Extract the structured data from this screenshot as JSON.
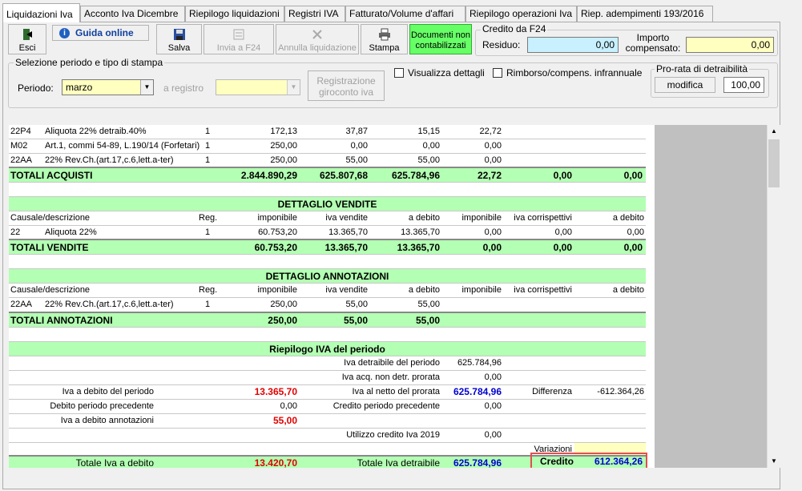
{
  "tabs": [
    "Liquidazioni Iva",
    "Acconto Iva Dicembre",
    "Riepilogo liquidazioni",
    "Registri IVA",
    "Fatturato/Volume d'affari",
    "Riepilogo operazioni Iva",
    "Riep. adempimenti 193/2016"
  ],
  "toolbar": {
    "esci": "Esci",
    "guida": "Guida online",
    "salva": "Salva",
    "invia": "Invia a F24",
    "annulla": "Annulla liquidazione",
    "stampa": "Stampa",
    "documenti_l1": "Documenti non",
    "documenti_l2": "contabilizzati"
  },
  "credito_f24": {
    "title": "Credito da F24",
    "residuo_label": "Residuo:",
    "residuo_value": "0,00",
    "importo_label_l1": "Importo",
    "importo_label_l2": "compensato:",
    "importo_value": "0,00"
  },
  "selezione": {
    "title": "Selezione periodo e tipo di stampa",
    "periodo_label": "Periodo:",
    "periodo_value": "marzo",
    "registro_label": "a registro",
    "registro_value": "",
    "registrazione_l1": "Registrazione",
    "registrazione_l2": "giroconto iva",
    "visualizza": "Visualizza dettagli",
    "rimborso": "Rimborso/compens. infrannuale"
  },
  "prorata": {
    "title": "Pro-rata di detraibilità",
    "modifica": "modifica",
    "value": "100,00"
  },
  "acquisti_rows": [
    [
      "22P4",
      "Aliquota 22% detraib.40%",
      "1",
      "172,13",
      "37,87",
      "15,15",
      "22,72"
    ],
    [
      "M02",
      "Art.1, commi 54-89, L.190/14 (Forfetari)",
      "1",
      "250,00",
      "0,00",
      "0,00",
      "0,00"
    ],
    [
      "22AA",
      "22% Rev.Ch.(art.17,c.6,lett.a-ter)",
      "1",
      "250,00",
      "55,00",
      "55,00",
      "0,00"
    ]
  ],
  "totali_acquisti": [
    "TOTALI ACQUISTI",
    "2.844.890,29",
    "625.807,68",
    "625.784,96",
    "22,72",
    "0,00",
    "0,00"
  ],
  "vendite": {
    "title": "DETTAGLIO VENDITE",
    "headers": [
      "Causale/descrizione",
      "Reg.",
      "imponibile",
      "iva vendite",
      "a debito",
      "imponibile",
      "iva corrispettivi",
      "a debito"
    ],
    "rows": [
      [
        "22",
        "Aliquota 22%",
        "1",
        "60.753,20",
        "13.365,70",
        "13.365,70",
        "0,00",
        "0,00",
        "0,00"
      ]
    ],
    "totali": [
      "TOTALI VENDITE",
      "60.753,20",
      "13.365,70",
      "13.365,70",
      "0,00",
      "0,00",
      "0,00"
    ]
  },
  "annotazioni": {
    "title": "DETTAGLIO ANNOTAZIONI",
    "headers": [
      "Causale/descrizione",
      "Reg.",
      "imponibile",
      "iva vendite",
      "a debito",
      "imponibile",
      "iva corrispettivi",
      "a debito"
    ],
    "rows": [
      [
        "22AA",
        "22% Rev.Ch.(art.17,c.6,lett.a-ter)",
        "1",
        "250,00",
        "55,00",
        "55,00"
      ]
    ],
    "totali": [
      "TOTALI ANNOTAZIONI",
      "250,00",
      "55,00",
      "55,00"
    ]
  },
  "riepilogo": {
    "title": "Riepilogo IVA del periodo",
    "iva_detraibile_label": "Iva detraibile del periodo",
    "iva_detraibile_value": "625.784,96",
    "iva_acq_label": "Iva acq. non detr. prorata",
    "iva_acq_value": "0,00",
    "iva_debito_label": "Iva a debito del periodo",
    "iva_debito_value": "13.365,70",
    "iva_netto_label": "Iva al netto del prorata",
    "iva_netto_value": "625.784,96",
    "differenza_label": "Differenza",
    "differenza_value": "-612.364,26",
    "debito_prec_label": "Debito periodo precedente",
    "debito_prec_value": "0,00",
    "credito_prec_label": "Credito periodo precedente",
    "credito_prec_value": "0,00",
    "iva_annot_label": "Iva a debito annotazioni",
    "iva_annot_value": "55,00",
    "utilizzo_label": "Utilizzo credito Iva 2019",
    "utilizzo_value": "0,00",
    "variazioni_label": "Variazioni",
    "variazioni_value": "",
    "totale_debito_label": "Totale Iva a debito",
    "totale_debito_value": "13.420,70",
    "totale_detr_label": "Totale Iva detraibile",
    "totale_detr_value": "625.784,96",
    "credito_label": "Credito",
    "credito_value": "612.364,26"
  },
  "colors": {
    "green": "#b3ffb3",
    "red": "#e00000",
    "blue": "#0000d0",
    "highlight": "#e05050"
  }
}
